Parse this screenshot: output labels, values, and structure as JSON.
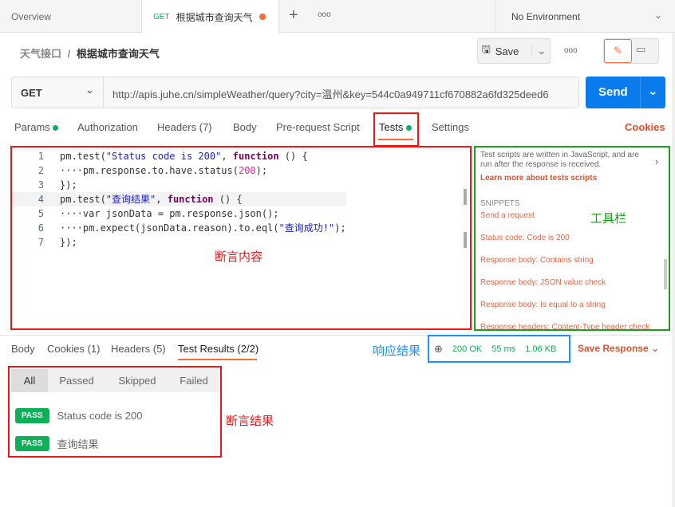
{
  "tabs": {
    "overview": "Overview",
    "active_method": "GET",
    "active_name": "根据城市查询天气",
    "new": "+",
    "more": "ooo",
    "environment": "No Environment"
  },
  "breadcrumb": {
    "collection": "天气接口",
    "sep": "/",
    "request": "根据城市查询天气"
  },
  "toolbar": {
    "save": "Save",
    "more": "ooo"
  },
  "request": {
    "method": "GET",
    "url": "http://apis.juhe.cn/simpleWeather/query?city=温州&key=544c0a949711cf670882a6fd325deed6",
    "send": "Send"
  },
  "req_tabs": [
    "Params",
    "Authorization",
    "Headers (7)",
    "Body",
    "Pre-request Script",
    "Tests",
    "Settings"
  ],
  "cookies": "Cookies",
  "code": {
    "l1": "1",
    "l2": "2",
    "l3": "3",
    "l4": "4",
    "l5": "5",
    "l6": "6",
    "l7": "7",
    "c1a": "pm.",
    "c1b": "test",
    "c1c": "(",
    "c1d": "\"Status code is 200\"",
    "c1e": ", ",
    "c1f": "function",
    "c1g": " () {",
    "c2a": "····pm.response.to.have.status(",
    "c2b": "200",
    "c2c": ");",
    "c3": "});",
    "c4a": "pm.",
    "c4b": "test",
    "c4c": "(",
    "c4d": "\"查询结果\"",
    "c4e": ", ",
    "c4f": "function",
    "c4g": " () {",
    "c5": "····var jsonData = pm.response.json();",
    "c6a": "····pm.expect(jsonData.reason).to.eql(",
    "c6b": "\"查询成功!\"",
    "c6c": ");",
    "c7": "});"
  },
  "annotations": {
    "assert_content": "断言内容",
    "toolbar": "工具栏",
    "response_result": "响应结果",
    "assert_result": "断言结果"
  },
  "snippets": {
    "intro": "Test scripts are written in JavaScript, and are run after the response is received.",
    "learn": "Learn more about tests scripts",
    "heading": "SNIPPETS",
    "items": [
      "Send a request",
      "Status code: Code is 200",
      "Response body: Contains string",
      "Response body: JSON value check",
      "Response body: Is equal to a string",
      "Response headers: Content-Type header check"
    ]
  },
  "resp_tabs": [
    "Body",
    "Cookies (1)",
    "Headers (5)",
    "Test Results (2/2)"
  ],
  "status": {
    "code": "200 OK",
    "time": "55 ms",
    "size": "1.06 KB",
    "save": "Save Response"
  },
  "filters": [
    "All",
    "Passed",
    "Skipped",
    "Failed"
  ],
  "results": [
    {
      "badge": "PASS",
      "name": "Status code is 200"
    },
    {
      "badge": "PASS",
      "name": "查询结果"
    }
  ],
  "colors": {
    "accent": "#ff6c37",
    "send": "#097bed",
    "pass": "#0cb057",
    "annotation_red": "#f01414",
    "annotation_green": "#1aa01a",
    "annotation_blue": "#1e90ff"
  }
}
